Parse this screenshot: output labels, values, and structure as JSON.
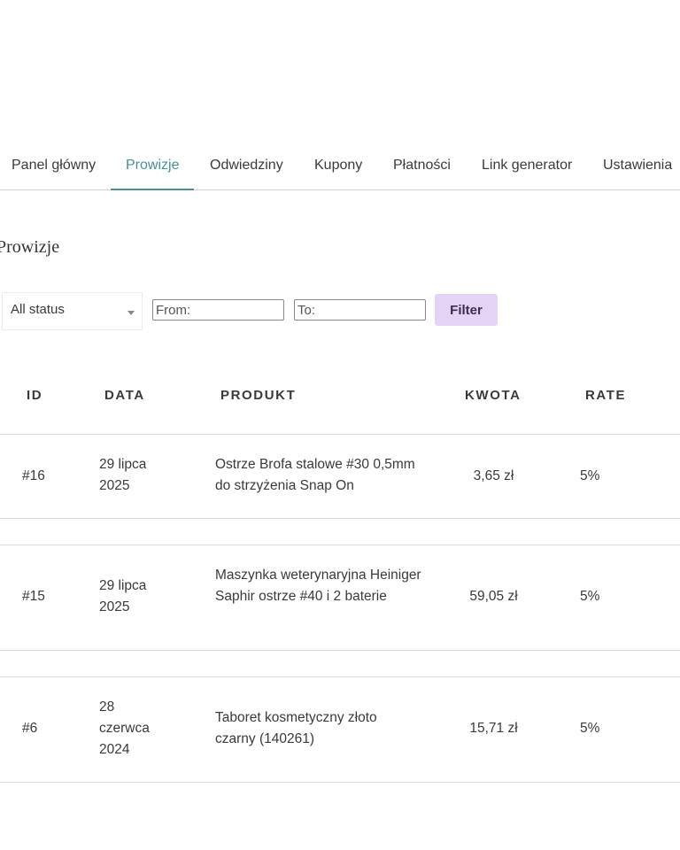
{
  "tabs": [
    {
      "label": "Panel główny",
      "active": false
    },
    {
      "label": "Prowizje",
      "active": true
    },
    {
      "label": "Odwiedziny",
      "active": false
    },
    {
      "label": "Kupony",
      "active": false
    },
    {
      "label": "Płatności",
      "active": false
    },
    {
      "label": "Link generator",
      "active": false
    },
    {
      "label": "Ustawienia",
      "active": false
    }
  ],
  "page_title": "Prowizje",
  "filters": {
    "status_value": "All status",
    "from_placeholder": "From:",
    "to_placeholder": "To:",
    "filter_label": "Filter"
  },
  "table": {
    "headers": [
      "ID",
      "DATA",
      "PRODUKT",
      "KWOTA",
      "RATE"
    ],
    "rows": [
      {
        "id": "#16",
        "date": "29 lipca 2025",
        "product": "Ostrze Brofa stalowe #30 0,5mm do strzyżenia Snap On",
        "amount": "3,65 zł",
        "rate": "5%"
      },
      {
        "id": "#15",
        "date": "29 lipca 2025",
        "product": "Maszynka weterynaryjna Heiniger Saphir ostrze #40 i 2 baterie",
        "amount": "59,05 zł",
        "rate": "5%"
      },
      {
        "id": "#6",
        "date": "28 czerwca 2024",
        "product": "Taboret kosmetyczny złoto czarny (140261)",
        "amount": "15,71 zł",
        "rate": "5%"
      }
    ]
  },
  "colors": {
    "accent": "#4a8f96",
    "filter_button": "#e3d3f4",
    "divider": "#dcdcdc"
  }
}
